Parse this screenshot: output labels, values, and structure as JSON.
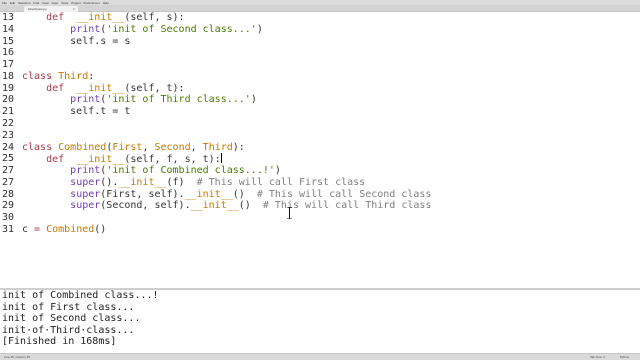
{
  "menu": [
    "File",
    "Edit",
    "Selection",
    "Find",
    "View",
    "Goto",
    "Tools",
    "Project",
    "Preferences",
    "Help"
  ],
  "tab": {
    "label": "inheritance.py",
    "close": "×"
  },
  "editor": {
    "lines": [
      {
        "num": "13",
        "tokens": [
          [
            "ind",
            "    "
          ],
          [
            "kw",
            "def"
          ],
          [
            "",
            "  "
          ],
          [
            "fn",
            "__init__"
          ],
          [
            "",
            "(self, s):"
          ]
        ]
      },
      {
        "num": "14",
        "tokens": [
          [
            "",
            "        "
          ],
          [
            "bi",
            "print"
          ],
          [
            "",
            "("
          ],
          [
            "str",
            "'init of Second class...'"
          ],
          [
            "",
            ")"
          ]
        ]
      },
      {
        "num": "15",
        "tokens": [
          [
            "",
            "        self.s = s"
          ]
        ]
      },
      {
        "num": "16",
        "tokens": []
      },
      {
        "num": "17",
        "tokens": []
      },
      {
        "num": "18",
        "tokens": [
          [
            "kw",
            "class"
          ],
          [
            "",
            " "
          ],
          [
            "fn",
            "Third"
          ],
          [
            "",
            ":"
          ]
        ]
      },
      {
        "num": "19",
        "tokens": [
          [
            "",
            "    "
          ],
          [
            "kw",
            "def"
          ],
          [
            "",
            "  "
          ],
          [
            "fn",
            "__init__"
          ],
          [
            "",
            "(self, t):"
          ]
        ]
      },
      {
        "num": "20",
        "tokens": [
          [
            "",
            "        "
          ],
          [
            "bi",
            "print"
          ],
          [
            "",
            "("
          ],
          [
            "str",
            "'init of Third class...'"
          ],
          [
            "",
            ")"
          ]
        ]
      },
      {
        "num": "21",
        "tokens": [
          [
            "",
            "        self.t = t"
          ]
        ]
      },
      {
        "num": "22",
        "tokens": []
      },
      {
        "num": "23",
        "tokens": []
      },
      {
        "num": "24",
        "tokens": [
          [
            "kw",
            "class"
          ],
          [
            "",
            " "
          ],
          [
            "fn",
            "Combined"
          ],
          [
            "",
            "("
          ],
          [
            "fn",
            "First"
          ],
          [
            "",
            ", "
          ],
          [
            "fn",
            "Second"
          ],
          [
            "",
            ", "
          ],
          [
            "fn",
            "Third"
          ],
          [
            "",
            "):"
          ]
        ]
      },
      {
        "num": "25",
        "tokens": [
          [
            "",
            "    "
          ],
          [
            "kw",
            "def"
          ],
          [
            "",
            "  "
          ],
          [
            "fn",
            "__init__"
          ],
          [
            "",
            "(self, f, s, t):"
          ]
        ],
        "caret": true
      },
      {
        "num": "27",
        "tokens": [
          [
            "",
            "        "
          ],
          [
            "bi",
            "print"
          ],
          [
            "",
            "("
          ],
          [
            "str",
            "'init of Combined class...!'"
          ],
          [
            "",
            ")"
          ]
        ]
      },
      {
        "num": "27",
        "tokens": [
          [
            "",
            "        "
          ],
          [
            "bi",
            "super"
          ],
          [
            "",
            "()."
          ],
          [
            "fn",
            "__init__"
          ],
          [
            "",
            "(f)  "
          ],
          [
            "cm",
            "# This will call First class"
          ]
        ]
      },
      {
        "num": "28",
        "tokens": [
          [
            "",
            "        "
          ],
          [
            "bi",
            "super"
          ],
          [
            "",
            "(First, self)."
          ],
          [
            "fn",
            "__init__"
          ],
          [
            "",
            "()  "
          ],
          [
            "cm",
            "# This will call Second class"
          ]
        ]
      },
      {
        "num": "29",
        "tokens": [
          [
            "",
            "        "
          ],
          [
            "bi",
            "super"
          ],
          [
            "",
            "(Second, self)."
          ],
          [
            "fn",
            "__init__"
          ],
          [
            "",
            "()  "
          ],
          [
            "cm",
            "# This will call Third class"
          ]
        ]
      },
      {
        "num": "30",
        "tokens": []
      },
      {
        "num": "31",
        "tokens": [
          [
            "",
            "c "
          ],
          [
            "kw",
            "="
          ],
          [
            "",
            " "
          ],
          [
            "fn",
            "Combined"
          ],
          [
            "",
            "()"
          ]
        ]
      }
    ]
  },
  "output": {
    "lines": [
      "init of Combined class...!",
      "init of First class...",
      "init of Second class...",
      "init·of·Third·class...",
      "[Finished in 168ms]"
    ]
  },
  "status": {
    "left": "Line 25, Column 25",
    "right_tab": "Tab Size: 4",
    "syntax": "Python"
  },
  "colors": {
    "keyword": "#a8384c",
    "function": "#c27a00",
    "string": "#4b7b00",
    "comment": "#808080",
    "builtin": "#6c3fb5"
  }
}
